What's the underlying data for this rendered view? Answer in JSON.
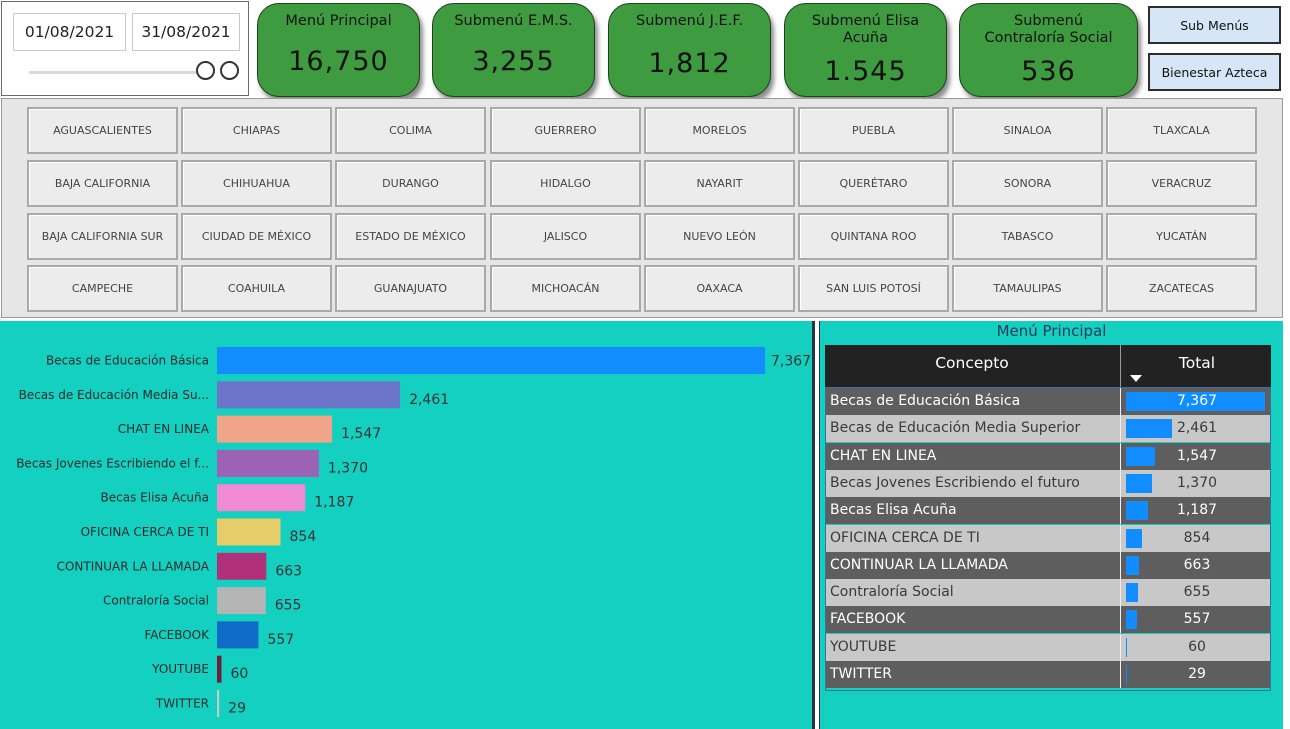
{
  "date_range": {
    "start": "01/08/2021",
    "end": "31/08/2021"
  },
  "kpis": [
    {
      "title": "Menú Principal",
      "value": "16,750"
    },
    {
      "title": "Submenú E.M.S.",
      "value": "3,255"
    },
    {
      "title": "Submenú J.E.F.",
      "value": "1,812"
    },
    {
      "title": "Submenú Elisa Acuña",
      "value": "1.545"
    },
    {
      "title": "Submenú Contraloría Social",
      "value": "536"
    }
  ],
  "nav": {
    "sub_menus": "Sub Menús",
    "bienestar": "Bienestar Azteca"
  },
  "states": [
    [
      "AGUASCALIENTES",
      "CHIAPAS",
      "COLIMA",
      "GUERRERO",
      "MORELOS",
      "PUEBLA",
      "SINALOA",
      "TLAXCALA"
    ],
    [
      "BAJA CALIFORNIA",
      "CHIHUAHUA",
      "DURANGO",
      "HIDALGO",
      "NAYARIT",
      "QUERÉTARO",
      "SONORA",
      "VERACRUZ"
    ],
    [
      "BAJA CALIFORNIA SUR",
      "CIUDAD DE MÉXICO",
      "ESTADO DE MÉXICO",
      "JALISCO",
      "NUEVO LEÓN",
      "QUINTANA ROO",
      "TABASCO",
      "YUCATÁN"
    ],
    [
      "CAMPECHE",
      "COAHUILA",
      "GUANAJUATO",
      "MICHOACÁN",
      "OAXACA",
      "SAN LUIS POTOSÍ",
      "TAMAULIPAS",
      "ZACATECAS"
    ]
  ],
  "chart_data": {
    "type": "bar",
    "orientation": "horizontal",
    "title": "",
    "categories": [
      "Becas de Educación Básica",
      "Becas de Educación Media Su...",
      "CHAT EN LINEA",
      "Becas Jovenes Escribiendo el f...",
      "Becas Elisa Acuña",
      "OFICINA CERCA DE TI",
      "CONTINUAR LA LLAMADA",
      "Contraloría Social",
      "FACEBOOK",
      "YOUTUBE",
      "TWITTER"
    ],
    "values": [
      7367,
      2461,
      1547,
      1370,
      1187,
      854,
      663,
      655,
      557,
      60,
      29
    ],
    "value_labels": [
      "7,367",
      "2,461",
      "1,547",
      "1,370",
      "1,187",
      "854",
      "663",
      "655",
      "557",
      "60",
      "29"
    ],
    "colors": [
      "#118dff",
      "#6b74c9",
      "#f0a58a",
      "#9c62b6",
      "#f08ad2",
      "#e6cd6a",
      "#b0307a",
      "#b5b5b5",
      "#0f6bc6",
      "#6e1f3c",
      "#c9c9c9"
    ],
    "xlim": [
      0,
      7367
    ],
    "grid": false,
    "legend": "none"
  },
  "table": {
    "title": "Menú Principal",
    "col_concept": "Concepto",
    "col_total": "Total",
    "rows": [
      {
        "concept": "Becas de Educación Básica",
        "total": "7,367",
        "value": 7367
      },
      {
        "concept": "Becas de Educación Media Superior",
        "total": "2,461",
        "value": 2461
      },
      {
        "concept": "CHAT EN LINEA",
        "total": "1,547",
        "value": 1547
      },
      {
        "concept": "Becas Jovenes Escribiendo el futuro",
        "total": "1,370",
        "value": 1370
      },
      {
        "concept": "Becas Elisa Acuña",
        "total": "1,187",
        "value": 1187
      },
      {
        "concept": "OFICINA CERCA DE TI",
        "total": "854",
        "value": 854
      },
      {
        "concept": "CONTINUAR LA LLAMADA",
        "total": "663",
        "value": 663
      },
      {
        "concept": "Contraloría Social",
        "total": "655",
        "value": 655
      },
      {
        "concept": "FACEBOOK",
        "total": "557",
        "value": 557
      },
      {
        "concept": "YOUTUBE",
        "total": "60",
        "value": 60
      },
      {
        "concept": "TWITTER",
        "total": "29",
        "value": 29
      }
    ],
    "bar_color": "#118dff"
  }
}
